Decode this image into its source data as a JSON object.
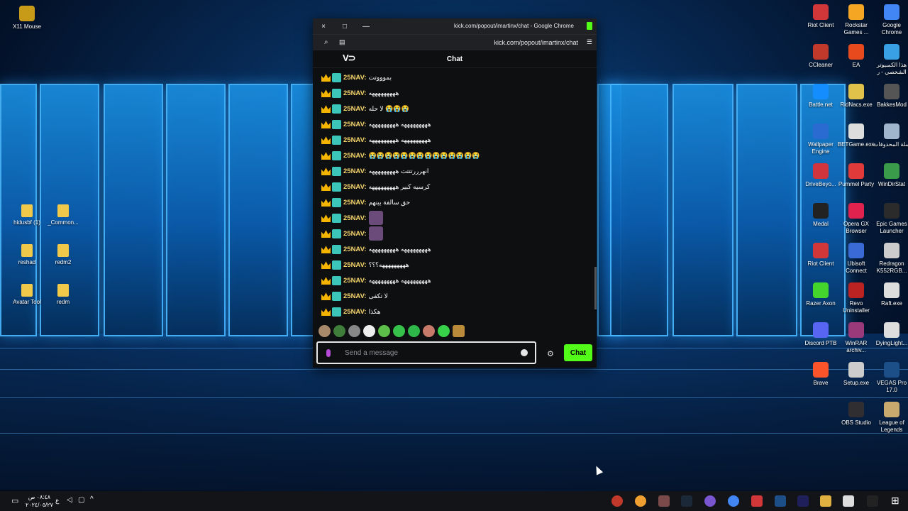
{
  "window": {
    "title": "kick.com/popout/imartinx/chat - Google Chrome",
    "url": "kick.com/popout/imartinx/chat",
    "close_icon": "×",
    "maximize_icon": "□",
    "minimize_icon": "—"
  },
  "chat": {
    "header": "Chat",
    "logo": "V⊃",
    "messages": [
      {
        "user": "25NAV:",
        "text": "بموووتت"
      },
      {
        "user": "25NAV:",
        "text": "هههههههههه"
      },
      {
        "user": "25NAV:",
        "text": "لا حله 😭😭😭"
      },
      {
        "user": "25NAV:",
        "text": "هههههههههه هههههههههه"
      },
      {
        "user": "25NAV:",
        "text": "هههههههههه هههههههههه"
      },
      {
        "user": "25NAV:",
        "text": "😭😭😭😭😭😭😭😭😭😭😭😭😭😭"
      },
      {
        "user": "25NAV:",
        "text": "انهرررتتتت هههههههههه"
      },
      {
        "user": "25NAV:",
        "text": "كرسيه كبير هههههههههه"
      },
      {
        "user": "25NAV:",
        "text": "حق سالفة بينهم"
      },
      {
        "user": "25NAV:",
        "text": "",
        "emote": true
      },
      {
        "user": "25NAV:",
        "text": "",
        "emote": true
      },
      {
        "user": "25NAV:",
        "text": "هههههههههه هههههههههه"
      },
      {
        "user": "25NAV:",
        "text": "هههههههههه؟؟؟"
      },
      {
        "user": "25NAV:",
        "text": "هههههههههه هههههههههه"
      },
      {
        "user": "25NAV:",
        "text": "لا تكفى"
      },
      {
        "user": "25NAV:",
        "text": "هكذا"
      }
    ],
    "input_placeholder": "Send a message",
    "send_label": "Chat"
  },
  "desktop_icons_left": [
    {
      "label": "X11 Mouse"
    },
    {
      "label": "hidusbf (1)"
    },
    {
      "label": "_Common..."
    },
    {
      "label": "reshad"
    },
    {
      "label": "redm2"
    },
    {
      "label": "Avatar Tool"
    },
    {
      "label": "redm"
    }
  ],
  "desktop_icons_right": [
    {
      "label": "Riot Client",
      "color": "#d13639"
    },
    {
      "label": "Rockstar Games ...",
      "color": "#f5a623"
    },
    {
      "label": "Google Chrome",
      "color": "#4285f4"
    },
    {
      "label": "CCleaner",
      "color": "#c0392b"
    },
    {
      "label": "EA",
      "color": "#e8491d"
    },
    {
      "label": "هذا الكمبيوتر الشخصي - ر",
      "color": "#3aa0e6"
    },
    {
      "label": "Battle.net",
      "color": "#148eff"
    },
    {
      "label": "RidNacs.exe",
      "color": "#e0c14a"
    },
    {
      "label": "BakkesMod",
      "color": "#555"
    },
    {
      "label": "Wallpaper Engine",
      "color": "#2a6bd1"
    },
    {
      "label": "BETGame.exe",
      "color": "#ddd"
    },
    {
      "label": "سلة المحذوفات",
      "color": "#9fb6cc"
    },
    {
      "label": "DriveBeyo...",
      "color": "#d1343c"
    },
    {
      "label": "Pummel Party",
      "color": "#e03a3a"
    },
    {
      "label": "WinDirStat",
      "color": "#3a9c4a"
    },
    {
      "label": "Medal",
      "color": "#222"
    },
    {
      "label": "Opera GX Browser",
      "color": "#e0234e"
    },
    {
      "label": "Epic Games Launcher",
      "color": "#2b2b2b"
    },
    {
      "label": "Riot Client",
      "color": "#d13639"
    },
    {
      "label": "Ubisoft Connect",
      "color": "#3a6ad6"
    },
    {
      "label": "Redragon K552RGB...",
      "color": "#ccc"
    },
    {
      "label": "Razer Axon",
      "color": "#44d62c"
    },
    {
      "label": "Revo Uninstaller",
      "color": "#b22"
    },
    {
      "label": "Raft.exe",
      "color": "#ddd"
    },
    {
      "label": "Discord PTB",
      "color": "#5865f2"
    },
    {
      "label": "WinRAR archiv...",
      "color": "#9b3a7a"
    },
    {
      "label": "DyingLight...",
      "color": "#ddd"
    },
    {
      "label": "Brave",
      "color": "#fb542b"
    },
    {
      "label": "Setup.exe",
      "color": "#ccc"
    },
    {
      "label": "VEGAS Pro 17.0",
      "color": "#1c4f88"
    },
    {
      "label": "OBS Studio",
      "color": "#302e31"
    },
    {
      "label": "League of Legends",
      "color": "#c8aa6e"
    }
  ],
  "taskbar": {
    "time": "٠٨:٤٨ ص",
    "date": "٢٠٢٤/٠٥/٢٧",
    "lang": "ع"
  }
}
